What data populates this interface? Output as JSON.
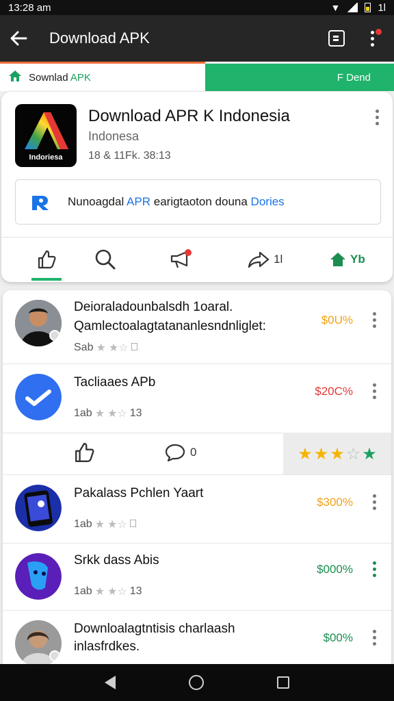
{
  "status_bar": {
    "time": "13:28 am",
    "battery_label": "1l"
  },
  "app_bar": {
    "title": "Download APK"
  },
  "tabs": {
    "left_prefix": "Sownlad",
    "left_accent": "APK",
    "right_label": "F Dend"
  },
  "card": {
    "title": "Download APR K Indonesia",
    "subtitle": "Indonesa",
    "meta": "18 & 11Fk. 38:13",
    "icon_text": "Indoriesa",
    "banner_prefix": "Nunoagdal",
    "banner_accent": "APR",
    "banner_mid": "earigtaoton douna",
    "banner_link": "Dories",
    "actions": {
      "share_count": "1l",
      "trend_label": "Yb"
    }
  },
  "list": [
    {
      "title": "Deioraladounbalsdh 1oaral.",
      "title2": "Qamlectoalagtatananlesndnliglet:",
      "meta_prefix": "Sab",
      "meta_suffix": "",
      "price": "$0U%",
      "price_color": "#f0a216",
      "avatar": "person-dark"
    },
    {
      "title": "Tacliaaes APb",
      "title2": "",
      "meta_prefix": "1ab",
      "meta_suffix": "13",
      "price": "$20C%",
      "price_color": "#e53935",
      "avatar": "blue-check"
    },
    {
      "title": "Pakalass Pchlen Yaart",
      "title2": "",
      "meta_prefix": "1ab",
      "meta_suffix": "",
      "price": "$300%",
      "price_color": "#f0a216",
      "avatar": "phone-blue"
    },
    {
      "title": "Srkk dass Abis",
      "title2": "",
      "meta_prefix": "1ab",
      "meta_suffix": "13",
      "price": "$000%",
      "price_color": "#1a8d4f",
      "avatar": "mask-blue"
    },
    {
      "title": "Downloalagtntisis charlaash",
      "title2": "inlasfrdkes.",
      "meta_prefix": "",
      "meta_suffix": "",
      "price": "$00%",
      "price_color": "#1a8d4f",
      "avatar": "person-woman"
    }
  ],
  "engage": {
    "comment_count": "0"
  },
  "colors": {
    "accent_green": "#1fb36b",
    "appbar": "#262626",
    "orange_line": "#ef6c3a"
  }
}
